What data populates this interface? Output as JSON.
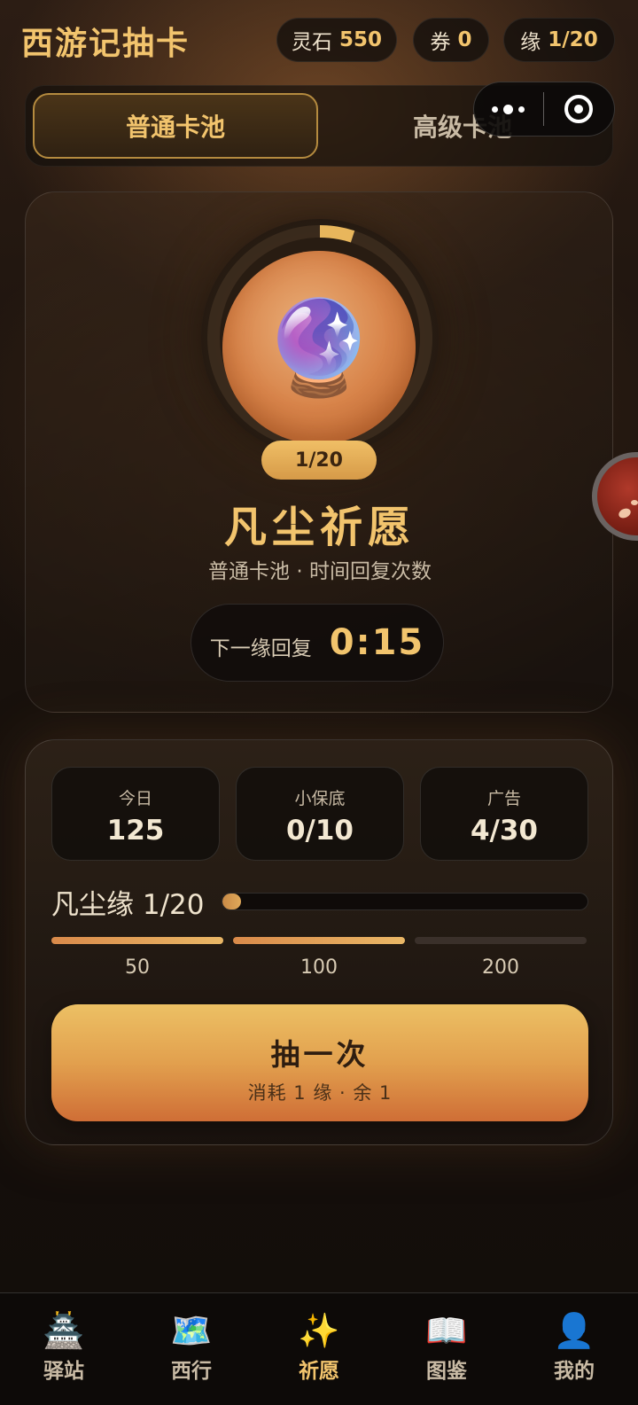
{
  "header": {
    "title": "西游记抽卡",
    "lingshi_label": "灵石",
    "lingshi_value": "550",
    "quan_label": "券",
    "quan_value": "0",
    "yuan_label": "缘",
    "yuan_value": "1/20"
  },
  "tabs": [
    {
      "label": "普通卡池",
      "active": true
    },
    {
      "label": "高级卡池",
      "active": false
    }
  ],
  "capsule": {
    "more_icon": "more-dots-icon",
    "close_icon": "target-circle-icon"
  },
  "pool": {
    "icon": "crystal-ball",
    "icon_glyph": "🔮",
    "progress_text": "1/20",
    "progress_fraction": 0.05,
    "name": "凡尘祈愿",
    "description": "普通卡池 · 时间回复次数",
    "recover_label": "下一缘回复",
    "recover_time": "0:15"
  },
  "stats": [
    {
      "label": "今日",
      "value": "125"
    },
    {
      "label": "小保底",
      "value": "0/10"
    },
    {
      "label": "广告",
      "value": "4/30"
    }
  ],
  "fate": {
    "label": "凡尘缘 1/20",
    "fraction": 0.05
  },
  "milestones": [
    {
      "label": "50",
      "reached": true
    },
    {
      "label": "100",
      "reached": true
    },
    {
      "label": "200",
      "reached": false
    }
  ],
  "draw_button": {
    "title": "抽一次",
    "subtitle": "消耗 1 缘 · 余 1"
  },
  "bottom_nav": [
    {
      "label": "驿站",
      "icon": "🏯",
      "active": false
    },
    {
      "label": "西行",
      "icon": "🗺️",
      "active": false
    },
    {
      "label": "祈愿",
      "icon": "✨",
      "active": true
    },
    {
      "label": "图鉴",
      "icon": "📖",
      "active": false
    },
    {
      "label": "我的",
      "icon": "👤",
      "active": false
    }
  ],
  "colors": {
    "accent_gold": "#f2c46d",
    "button_top": "#ecc064",
    "button_bottom": "#cf6e36",
    "background": "#140f0c"
  }
}
